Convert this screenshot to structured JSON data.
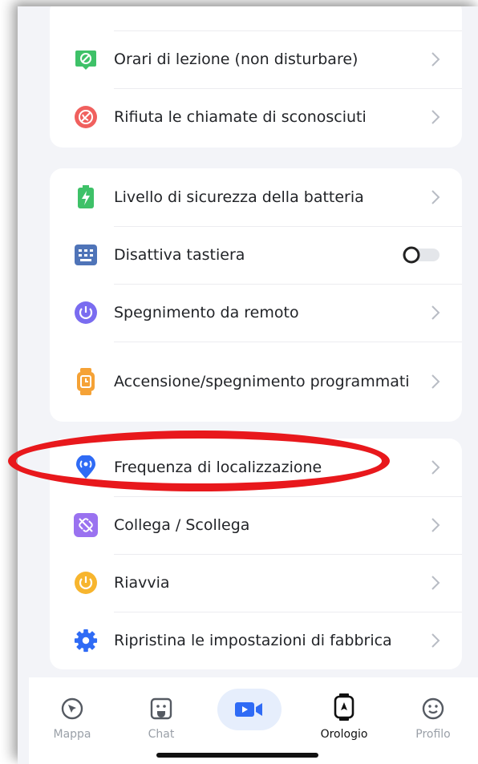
{
  "settings": {
    "group1": [
      {
        "label": "Orari di lezione (non disturbare)",
        "icon": "do-not-disturb-icon"
      },
      {
        "label": "Rifiuta le chiamate di sconosciuti",
        "icon": "block-calls-icon"
      }
    ],
    "group2": [
      {
        "label": "Livello di sicurezza della batteria",
        "icon": "battery-icon"
      },
      {
        "label": "Disattiva tastiera",
        "icon": "keyboard-icon",
        "toggle": false
      },
      {
        "label": "Spegnimento da remoto",
        "icon": "power-icon"
      },
      {
        "label": "Accensione/spegnimento programmati",
        "icon": "scheduled-watch-icon"
      }
    ],
    "group3": [
      {
        "label": "Frequenza di localizzazione",
        "icon": "location-signal-icon"
      },
      {
        "label": "Collega / Scollega",
        "icon": "unlink-icon"
      },
      {
        "label": "Riavvia",
        "icon": "restart-icon"
      },
      {
        "label": "Ripristina le impostazioni di fabbrica",
        "icon": "gear-icon"
      }
    ]
  },
  "tabbar": {
    "tabs": [
      {
        "label": "Mappa",
        "icon": "compass-icon",
        "active": false
      },
      {
        "label": "Chat",
        "icon": "chat-face-icon",
        "active": false
      },
      {
        "label": "",
        "icon": "video-call-icon",
        "active": false
      },
      {
        "label": "Orologio",
        "icon": "watch-icon",
        "active": true
      },
      {
        "label": "Profilo",
        "icon": "smiley-icon",
        "active": false
      }
    ]
  },
  "colors": {
    "accent_blue": "#2f6bf5",
    "annotation_red": "#e8181c",
    "green": "#3ec168",
    "red": "#f0605e",
    "purple": "#7a6cf0",
    "orange": "#f5a236"
  }
}
